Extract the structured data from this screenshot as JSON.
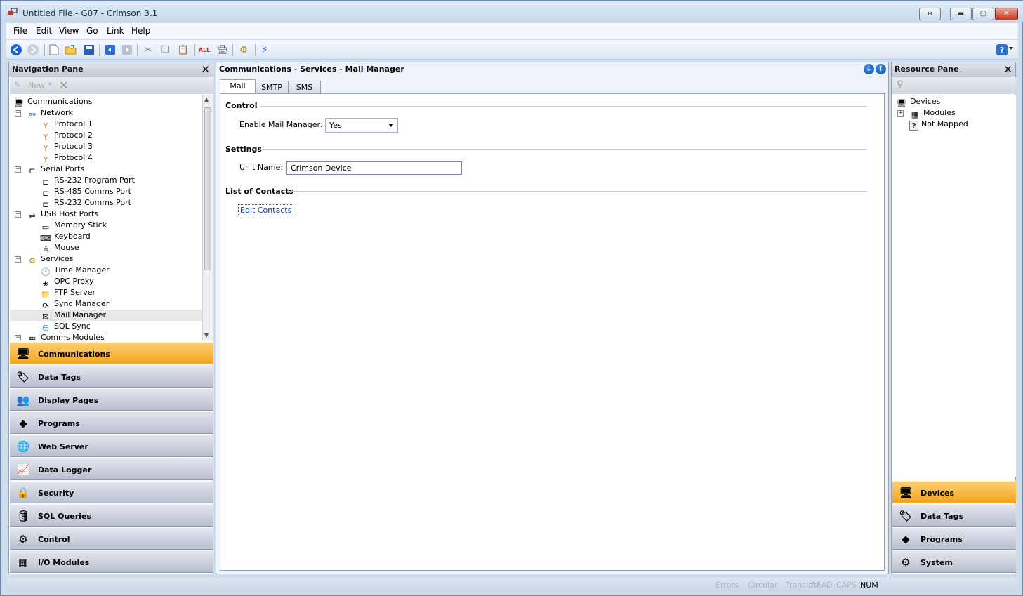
{
  "window": {
    "title": "Untitled File - G07 - Crimson 3.1",
    "controls": {
      "restore2": "⇔",
      "minimize": "▬",
      "maximize": "▢",
      "close": "✕"
    }
  },
  "menu": [
    "File",
    "Edit",
    "View",
    "Go",
    "Link",
    "Help"
  ],
  "toolbar_icons": [
    "back-icon",
    "forward-icon",
    "new-file-icon",
    "open-folder-icon",
    "save-icon",
    "undo-icon",
    "redo-icon",
    "cut-icon",
    "copy-icon",
    "paste-icon",
    "find-all-icon",
    "print-icon",
    "link-icon",
    "send-icon",
    "help-icon"
  ],
  "nav_pane": {
    "title": "Navigation Pane",
    "new_label": "New",
    "tree": [
      {
        "label": "Communications",
        "level": 0,
        "icon": "communications-icon",
        "expander": ""
      },
      {
        "label": "Network",
        "level": 1,
        "icon": "network-icon",
        "expander": "−"
      },
      {
        "label": "Protocol 1",
        "level": 2,
        "icon": "protocol-icon",
        "expander": ""
      },
      {
        "label": "Protocol 2",
        "level": 2,
        "icon": "protocol-icon",
        "expander": ""
      },
      {
        "label": "Protocol 3",
        "level": 2,
        "icon": "protocol-icon",
        "expander": ""
      },
      {
        "label": "Protocol 4",
        "level": 2,
        "icon": "protocol-icon",
        "expander": ""
      },
      {
        "label": "Serial Ports",
        "level": 1,
        "icon": "serial-port-icon",
        "expander": "−"
      },
      {
        "label": "RS-232 Program Port",
        "level": 2,
        "icon": "port-icon",
        "expander": ""
      },
      {
        "label": "RS-485 Comms Port",
        "level": 2,
        "icon": "port-icon",
        "expander": ""
      },
      {
        "label": "RS-232 Comms Port",
        "level": 2,
        "icon": "port-icon",
        "expander": ""
      },
      {
        "label": "USB Host Ports",
        "level": 1,
        "icon": "usb-icon",
        "expander": "−"
      },
      {
        "label": "Memory Stick",
        "level": 2,
        "icon": "memory-stick-icon",
        "expander": ""
      },
      {
        "label": "Keyboard",
        "level": 2,
        "icon": "keyboard-icon",
        "expander": ""
      },
      {
        "label": "Mouse",
        "level": 2,
        "icon": "mouse-icon",
        "expander": ""
      },
      {
        "label": "Services",
        "level": 1,
        "icon": "services-icon",
        "expander": "−"
      },
      {
        "label": "Time Manager",
        "level": 2,
        "icon": "time-manager-icon",
        "expander": ""
      },
      {
        "label": "OPC Proxy",
        "level": 2,
        "icon": "opc-proxy-icon",
        "expander": ""
      },
      {
        "label": "FTP Server",
        "level": 2,
        "icon": "ftp-server-icon",
        "expander": ""
      },
      {
        "label": "Sync Manager",
        "level": 2,
        "icon": "sync-manager-icon",
        "expander": ""
      },
      {
        "label": "Mail Manager",
        "level": 2,
        "icon": "mail-manager-icon",
        "expander": "",
        "selected": true
      },
      {
        "label": "SQL Sync",
        "level": 2,
        "icon": "sql-sync-icon",
        "expander": ""
      },
      {
        "label": "Comms Modules",
        "level": 1,
        "icon": "comms-modules-icon",
        "expander": "−"
      }
    ],
    "sections": [
      {
        "label": "Communications",
        "icon": "communications-icon",
        "glyph": "🖥",
        "active": true
      },
      {
        "label": "Data Tags",
        "icon": "data-tags-icon",
        "glyph": "🏷",
        "active": false
      },
      {
        "label": "Display Pages",
        "icon": "display-pages-icon",
        "glyph": "👥",
        "active": false
      },
      {
        "label": "Programs",
        "icon": "programs-icon",
        "glyph": "⬥",
        "active": false
      },
      {
        "label": "Web Server",
        "icon": "web-server-icon",
        "glyph": "🌐",
        "active": false
      },
      {
        "label": "Data Logger",
        "icon": "data-logger-icon",
        "glyph": "📈",
        "active": false
      },
      {
        "label": "Security",
        "icon": "security-icon",
        "glyph": "🔒",
        "active": false
      },
      {
        "label": "SQL Queries",
        "icon": "sql-queries-icon",
        "glyph": "🛢",
        "active": false
      },
      {
        "label": "Control",
        "icon": "control-icon",
        "glyph": "⚙",
        "active": false
      },
      {
        "label": "I/O Modules",
        "icon": "io-modules-icon",
        "glyph": "▦",
        "active": false
      }
    ]
  },
  "center": {
    "breadcrumb": "Communications - Services - Mail Manager",
    "tabs": [
      {
        "label": "Mail",
        "active": true
      },
      {
        "label": "SMTP",
        "active": false
      },
      {
        "label": "SMS",
        "active": false
      }
    ],
    "groups": {
      "control": "Control",
      "settings": "Settings",
      "contacts": "List of Contacts"
    },
    "fields": {
      "enable_label": "Enable Mail Manager:",
      "enable_value": "Yes",
      "unit_label": "Unit Name:",
      "unit_value": "Crimson Device",
      "edit_contacts": "Edit Contacts"
    }
  },
  "resource_pane": {
    "title": "Resource Pane",
    "tree": [
      {
        "label": "Devices",
        "level": 0,
        "icon": "devices-icon",
        "expander": ""
      },
      {
        "label": "Modules",
        "level": 1,
        "icon": "modules-icon",
        "expander": "+"
      },
      {
        "label": "Not Mapped",
        "level": 1,
        "icon": "not-mapped-icon",
        "expander": ""
      }
    ],
    "sections": [
      {
        "label": "Devices",
        "icon": "devices-icon",
        "glyph": "🖥",
        "active": true
      },
      {
        "label": "Data Tags",
        "icon": "data-tags-icon",
        "glyph": "🏷",
        "active": false
      },
      {
        "label": "Programs",
        "icon": "programs-icon",
        "glyph": "⬥",
        "active": false
      },
      {
        "label": "System",
        "icon": "system-icon",
        "glyph": "⚙",
        "active": false
      }
    ]
  },
  "status": {
    "items": [
      {
        "label": "Errors",
        "on": false
      },
      {
        "label": "Circular",
        "on": false
      },
      {
        "label": "Translate",
        "on": false
      },
      {
        "label": "READ",
        "on": false
      },
      {
        "label": "CAPS",
        "on": false
      },
      {
        "label": "NUM",
        "on": true
      }
    ]
  },
  "colors": {
    "accent": "#f4a520",
    "panel_header": "#c5ccd6",
    "link": "#1a3fb0"
  }
}
